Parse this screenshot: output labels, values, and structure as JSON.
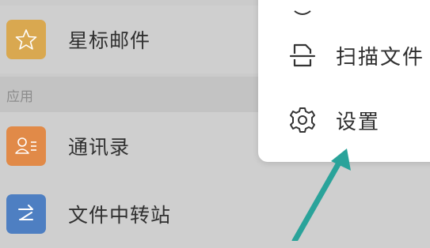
{
  "list": {
    "items": [
      {
        "label": "星标邮件",
        "icon": "star-icon",
        "color": "#d9a850"
      },
      {
        "label": "通讯录",
        "icon": "contacts-icon",
        "color": "#e18a48"
      },
      {
        "label": "文件中转站",
        "icon": "transfer-icon",
        "color": "#4e7fc2"
      }
    ],
    "section_label": "应用"
  },
  "menu": {
    "items": [
      {
        "label": "扫描文件",
        "icon": "scan-icon"
      },
      {
        "label": "设置",
        "icon": "gear-icon"
      }
    ]
  },
  "annotation": {
    "arrow_color": "#2aa39a"
  }
}
